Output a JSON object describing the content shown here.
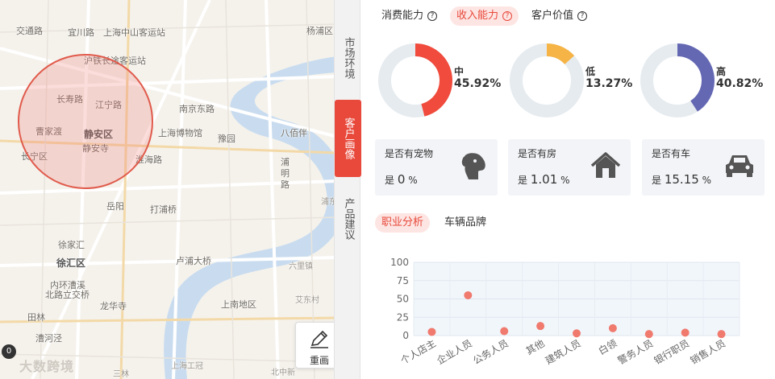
{
  "map": {
    "labels": [
      "交通路",
      "宜川路",
      "上海中山客运站",
      "杨浦区",
      "沪铁长途客运站",
      "长寿路",
      "江宁路",
      "南京东路",
      "曹家渡",
      "静安区",
      "静安寺",
      "上海博物馆",
      "豫园",
      "八佰伴",
      "长宁区",
      "淮海路",
      "浦明路",
      "岳阳",
      "打浦桥",
      "浦东",
      "徐家汇",
      "徐汇区",
      "卢浦大桥",
      "六里镇",
      "内环漕溪",
      "北路立交桥",
      "龙华寺",
      "上南地区",
      "艾东村",
      "田林",
      "漕河泾",
      "上海工冠",
      "北中新",
      "三林"
    ],
    "redraw_label": "重画",
    "zoom_badge": "0",
    "watermark": "大数跨境"
  },
  "vtabs": [
    {
      "label": "市场环境",
      "active": false
    },
    {
      "label": "客户画像",
      "active": true
    },
    {
      "label": "产品建议",
      "active": false
    }
  ],
  "tabs": [
    {
      "label": "消费能力",
      "active": false
    },
    {
      "label": "收入能力",
      "active": true
    },
    {
      "label": "客户价值",
      "active": false
    }
  ],
  "donuts": [
    {
      "level": "中",
      "percent": "45.92%",
      "value": 45.92,
      "color": "#f04b3c"
    },
    {
      "level": "低",
      "percent": "13.27%",
      "value": 13.27,
      "color": "#f5b445"
    },
    {
      "level": "高",
      "percent": "40.82%",
      "value": 40.82,
      "color": "#6468b3"
    }
  ],
  "cards": [
    {
      "title": "是否有宠物",
      "prefix": "是",
      "value": "0",
      "unit": "%",
      "icon": "dog-icon"
    },
    {
      "title": "是否有房",
      "prefix": "是",
      "value": "1.01",
      "unit": "%",
      "icon": "house-icon"
    },
    {
      "title": "是否有车",
      "prefix": "是",
      "value": "15.15",
      "unit": "%",
      "icon": "car-icon"
    }
  ],
  "subtabs": [
    {
      "label": "职业分析",
      "active": true
    },
    {
      "label": "车辆品牌",
      "active": false
    }
  ],
  "chart_data": {
    "type": "scatter",
    "categories": [
      "个人店主",
      "企业人员",
      "公务人员",
      "其他",
      "建筑人员",
      "白领",
      "警务人员",
      "银行职员",
      "销售人员"
    ],
    "values": [
      5,
      55,
      6,
      13,
      3,
      10,
      2,
      4,
      2
    ],
    "ylim": [
      0,
      100
    ],
    "yticks": [
      "0",
      "25",
      "50",
      "75",
      "100"
    ],
    "color": "#f07a6e",
    "grid": true
  }
}
